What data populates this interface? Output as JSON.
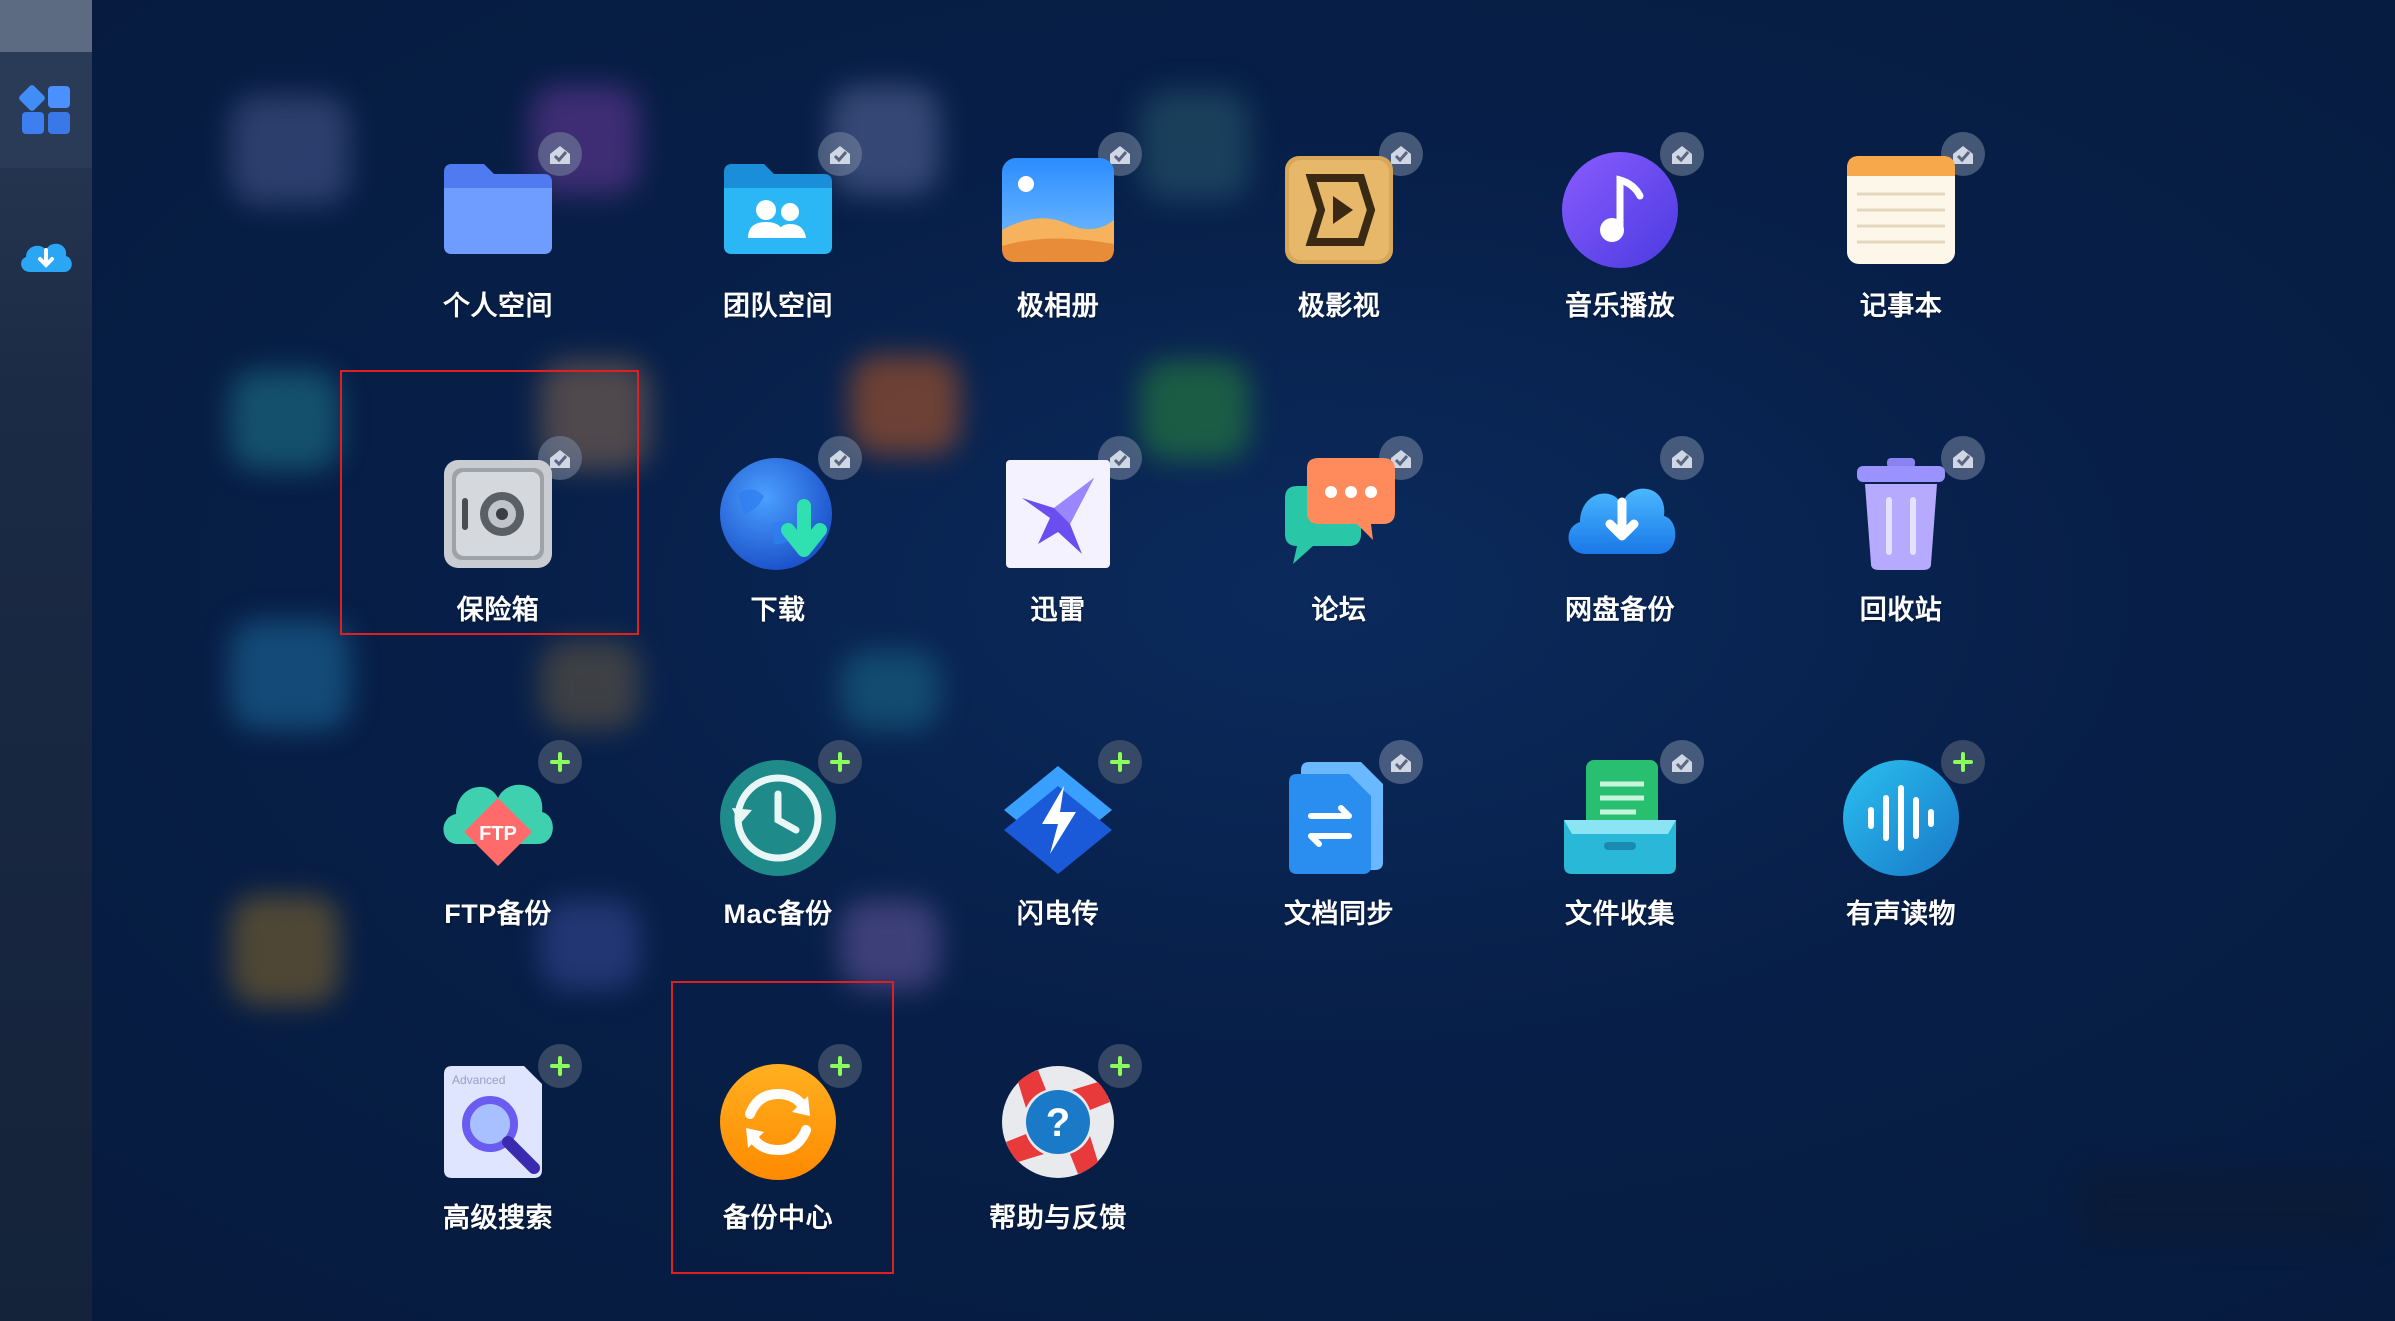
{
  "apps": [
    {
      "label": "个人空间",
      "icon": "folder-icon",
      "badge": "installed"
    },
    {
      "label": "团队空间",
      "icon": "team-folder-icon",
      "badge": "installed"
    },
    {
      "label": "极相册",
      "icon": "photo-album-icon",
      "badge": "installed"
    },
    {
      "label": "极影视",
      "icon": "video-icon",
      "badge": "installed"
    },
    {
      "label": "音乐播放",
      "icon": "music-icon",
      "badge": "installed"
    },
    {
      "label": "记事本",
      "icon": "notepad-icon",
      "badge": "installed"
    },
    {
      "label": "保险箱",
      "icon": "safe-icon",
      "badge": "installed"
    },
    {
      "label": "下载",
      "icon": "download-globe-icon",
      "badge": "installed"
    },
    {
      "label": "迅雷",
      "icon": "thunder-bird-icon",
      "badge": "installed"
    },
    {
      "label": "论坛",
      "icon": "forum-chat-icon",
      "badge": "installed"
    },
    {
      "label": "网盘备份",
      "icon": "cloud-download-icon",
      "badge": "installed"
    },
    {
      "label": "回收站",
      "icon": "trash-icon",
      "badge": "installed"
    },
    {
      "label": "FTP备份",
      "icon": "ftp-cloud-icon",
      "badge": "add"
    },
    {
      "label": "Mac备份",
      "icon": "clock-backup-icon",
      "badge": "add"
    },
    {
      "label": "闪电传",
      "icon": "lightning-icon",
      "badge": "add"
    },
    {
      "label": "文档同步",
      "icon": "doc-sync-icon",
      "badge": "installed"
    },
    {
      "label": "文件收集",
      "icon": "file-collect-icon",
      "badge": "installed"
    },
    {
      "label": "有声读物",
      "icon": "audiobook-icon",
      "badge": "add"
    },
    {
      "label": "高级搜索",
      "icon": "advanced-search-icon",
      "badge": "add",
      "icon_text": "Advanced"
    },
    {
      "label": "备份中心",
      "icon": "backup-center-icon",
      "badge": "add"
    },
    {
      "label": "帮助与反馈",
      "icon": "help-lifebuoy-icon",
      "badge": "add"
    }
  ],
  "dock": [
    {
      "icon": "app-grid-icon"
    },
    {
      "icon": "cloud-download-icon"
    }
  ],
  "ftp_icon_text": "FTP",
  "highlighted": [
    "保险箱",
    "备份中心"
  ],
  "colors": {
    "highlight": "#e02020",
    "background": "#071f48"
  }
}
